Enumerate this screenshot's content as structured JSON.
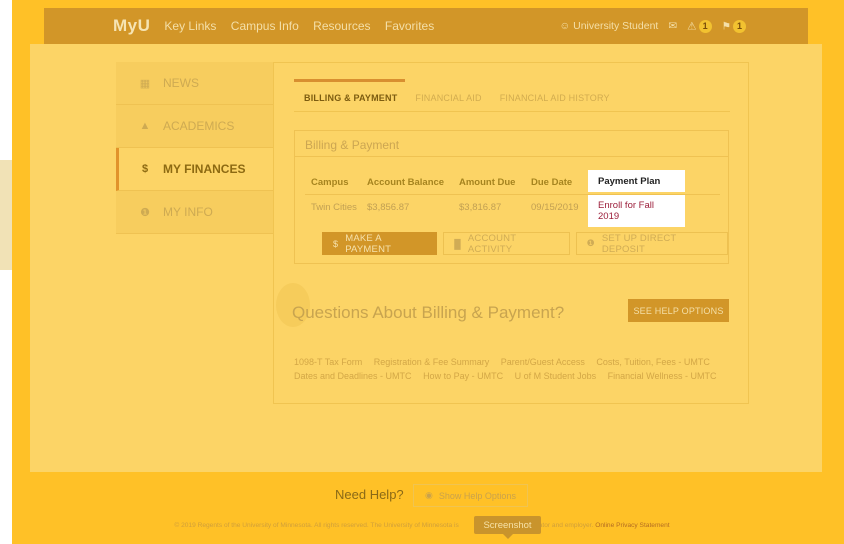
{
  "topbar": {
    "logo_text": "MyU",
    "nav": [
      "Key Links",
      "Campus Info",
      "Resources",
      "Favorites"
    ],
    "user_label": "University Student",
    "alert_count": "1",
    "flag_count": "1"
  },
  "menu": {
    "items": [
      {
        "icon": "newspaper-icon",
        "label": "NEWS"
      },
      {
        "icon": "graduation-cap-icon",
        "label": "ACADEMICS"
      },
      {
        "icon": "dollar-icon",
        "label": "MY FINANCES"
      },
      {
        "icon": "info-icon",
        "label": "MY INFO"
      }
    ]
  },
  "tabs": [
    "BILLING & PAYMENT",
    "FINANCIAL AID",
    "FINANCIAL AID HISTORY"
  ],
  "billing": {
    "title": "Billing & Payment",
    "headers": [
      "Campus",
      "Account Balance",
      "Amount Due",
      "Due Date",
      "Payment Plan"
    ],
    "row": [
      "Twin Cities",
      "$3,856.87",
      "$3,816.87",
      "09/15/2019",
      "Enroll for Fall 2019"
    ],
    "buttons": [
      "MAKE A PAYMENT",
      "ACCOUNT ACTIVITY",
      "SET UP DIRECT DEPOSIT"
    ]
  },
  "questions": {
    "title": "Questions About Billing & Payment?",
    "help_button": "SEE HELP OPTIONS",
    "links_row1": [
      "1098-T Tax Form",
      "Registration & Fee Summary",
      "Parent/Guest Access",
      "Costs, Tuition, Fees - UMTC"
    ],
    "links_row2": [
      "Dates and Deadlines - UMTC",
      "How to Pay - UMTC",
      "U of M Student Jobs",
      "Financial Wellness - UMTC"
    ]
  },
  "footer": {
    "need_help": "Need Help?",
    "show_help": "Show Help Options",
    "copyright_pre": "© 2019 Regents of the University of Minnesota. All rights reserved. The University of Minnesota is",
    "copyright_post": "educator and employer.",
    "privacy": "Online Privacy Statement",
    "tooltip": "Screenshot"
  },
  "colors": {
    "gold": "#ffc127",
    "nav_bar": "#d29628",
    "highlight_link": "#9c1f3b"
  }
}
